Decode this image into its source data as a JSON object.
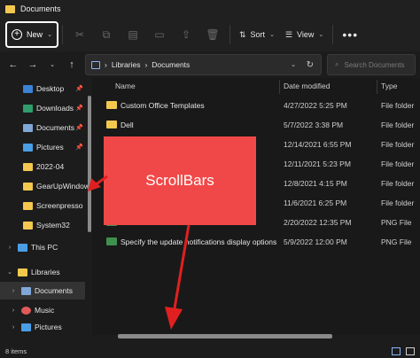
{
  "window": {
    "title": "Documents"
  },
  "toolbar": {
    "new_label": "New",
    "tools": [
      "cut-icon",
      "copy-icon",
      "paste-icon",
      "rename-icon",
      "share-icon",
      "delete-icon"
    ],
    "sort_label": "Sort",
    "view_label": "View",
    "more_label": "•••"
  },
  "address": {
    "crumbs": [
      "Libraries",
      "Documents"
    ],
    "search_placeholder": "Search Documents"
  },
  "sidebar": {
    "items": [
      {
        "label": "Desktop",
        "icon": "desktop-icon",
        "pinned": true,
        "color": "#3b82d6"
      },
      {
        "label": "Downloads",
        "icon": "downloads-icon",
        "pinned": true,
        "color": "#2f9e6b"
      },
      {
        "label": "Documents",
        "icon": "documents-icon",
        "pinned": true,
        "color": "#7fa7d8"
      },
      {
        "label": "Pictures",
        "icon": "pictures-icon",
        "pinned": true,
        "color": "#4a9ee6"
      },
      {
        "label": "2022-04",
        "icon": "folder-icon",
        "pinned": false,
        "color": "#f4c84f"
      },
      {
        "label": "GearUpWindow",
        "icon": "folder-icon",
        "pinned": false,
        "color": "#f4c84f"
      },
      {
        "label": "Screenpresso",
        "icon": "folder-icon",
        "pinned": false,
        "color": "#f4c84f"
      },
      {
        "label": "System32",
        "icon": "folder-icon",
        "pinned": false,
        "color": "#f4c84f"
      }
    ],
    "this_pc": "This PC",
    "libraries": "Libraries",
    "lib_items": [
      {
        "label": "Documents",
        "icon": "documents-icon",
        "color": "#7fa7d8"
      },
      {
        "label": "Music",
        "icon": "music-icon",
        "color": "#e05a5a"
      },
      {
        "label": "Pictures",
        "icon": "pictures-icon",
        "color": "#4a9ee6"
      }
    ]
  },
  "columns": {
    "name": "Name",
    "date": "Date modified",
    "type": "Type"
  },
  "files": [
    {
      "name": "Custom Office Templates",
      "date": "4/27/2022 5:25 PM",
      "type": "File folder",
      "icon": "folder-icon"
    },
    {
      "name": "Dell",
      "date": "5/7/2022 3:38 PM",
      "type": "File folder",
      "icon": "folder-icon"
    },
    {
      "name": "",
      "date": "12/14/2021 6:55 PM",
      "type": "File folder",
      "icon": "folder-icon"
    },
    {
      "name": "",
      "date": "12/11/2021 5:23 PM",
      "type": "File folder",
      "icon": "folder-icon"
    },
    {
      "name": "",
      "date": "12/8/2021 4:15 PM",
      "type": "File folder",
      "icon": "folder-icon"
    },
    {
      "name": "",
      "date": "11/6/2021 6:25 PM",
      "type": "File folder",
      "icon": "folder-icon"
    },
    {
      "name": "",
      "date": "2/20/2022 12:35 PM",
      "type": "PNG File",
      "icon": "image-file-icon"
    },
    {
      "name": "Specify the update notifications display options",
      "date": "5/9/2022 12:00 PM",
      "type": "PNG File",
      "icon": "image-file-icon"
    }
  ],
  "status": {
    "items": "8 items"
  },
  "annotation": {
    "label": "ScrollBars",
    "box_color": "#f04848",
    "arrow_color": "#e02020"
  }
}
